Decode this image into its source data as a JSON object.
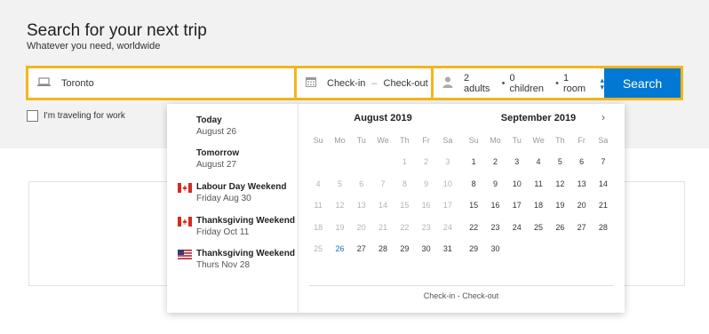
{
  "header": {
    "title": "Search for your next trip",
    "subtitle": "Whatever you need, worldwide"
  },
  "search": {
    "destination": "Toronto",
    "checkin": "Check-in",
    "checkout": "Check-out",
    "adults": "2 adults",
    "children": "0 children",
    "rooms": "1 room",
    "button": "Search",
    "accent": "#f3b61b",
    "button_color": "#0078d4"
  },
  "work_checkbox": {
    "label": "I'm traveling for work",
    "checked": false
  },
  "quick_dates": [
    {
      "title": "Today",
      "sub": "August 26",
      "flag": ""
    },
    {
      "title": "Tomorrow",
      "sub": "August 27",
      "flag": ""
    },
    {
      "title": "Labour Day Weekend",
      "sub": "Friday Aug 30",
      "flag": "canada-flag-icon"
    },
    {
      "title": "Thanksgiving Weekend",
      "sub": "Friday Oct 11",
      "flag": "canada-flag-icon"
    },
    {
      "title": "Thanksgiving Weekend",
      "sub": "Thurs Nov 28",
      "flag": "us-flag-icon"
    }
  ],
  "calendar": {
    "weekdays": [
      "Su",
      "Mo",
      "Tu",
      "We",
      "Th",
      "Fr",
      "Sa"
    ],
    "months": [
      {
        "title": "August 2019",
        "lead_blanks": 4,
        "days": 31,
        "disabled_through": 25,
        "today": 26
      },
      {
        "title": "September 2019",
        "lead_blanks": 0,
        "days": 30,
        "disabled_through": 0,
        "today": null
      }
    ],
    "footer": "Check-in - Check-out",
    "today_color": "#1a73c8"
  }
}
